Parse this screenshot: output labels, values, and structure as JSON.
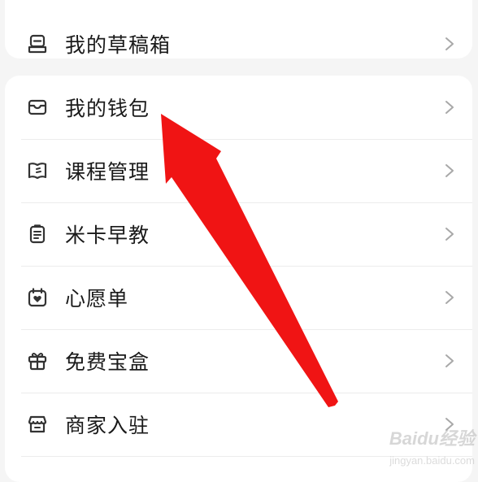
{
  "menu_top": {
    "items": [
      {
        "label": "我的草稿箱",
        "icon": "drafts-icon"
      }
    ]
  },
  "menu_main": {
    "items": [
      {
        "label": "我的钱包",
        "icon": "wallet-icon"
      },
      {
        "label": "课程管理",
        "icon": "course-book-icon"
      },
      {
        "label": "米卡早教",
        "icon": "clipboard-icon"
      },
      {
        "label": "心愿单",
        "icon": "heart-calendar-icon"
      },
      {
        "label": "免费宝盒",
        "icon": "gift-box-icon"
      },
      {
        "label": "商家入驻",
        "icon": "store-icon"
      }
    ]
  },
  "annotation": {
    "arrow_color": "#f01414"
  },
  "watermark": {
    "text": "Baidu经验",
    "sub": "jingyan.baidu.com"
  },
  "colors": {
    "background": "#f5f5f5",
    "card": "#ffffff",
    "text": "#1a1a1a",
    "icon": "#333333",
    "chevron": "#a8a8a8"
  }
}
